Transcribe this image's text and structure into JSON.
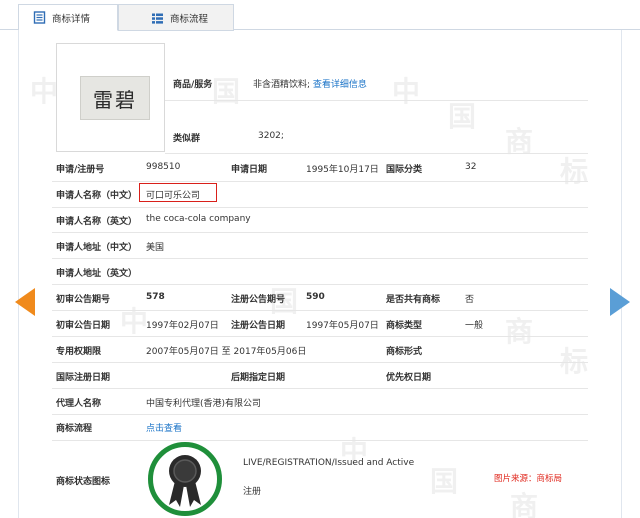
{
  "tabs": [
    {
      "label": "商标详情",
      "icon": "document-icon",
      "active": true
    },
    {
      "label": "商标流程",
      "icon": "list-icon",
      "active": false
    }
  ],
  "watermark": [
    "中",
    "国",
    "商",
    "标"
  ],
  "trademark_image_text": "雷碧",
  "goods": {
    "label": "商品/服务",
    "value": "非含酒精饮料;",
    "link": "查看详细信息"
  },
  "similar_group": {
    "label": "类似群",
    "value": "3202;"
  },
  "rows": {
    "reg_no": {
      "label": "申请/注册号",
      "value": "998510"
    },
    "app_date": {
      "label": "申请日期",
      "value": "1995年10月17日"
    },
    "intl_class": {
      "label": "国际分类",
      "value": "32"
    },
    "applicant_cn": {
      "label": "申请人名称（中文）",
      "value": "可口可乐公司"
    },
    "applicant_en": {
      "label": "申请人名称（英文）",
      "value": "the coca-cola company"
    },
    "address_cn": {
      "label": "申请人地址（中文）",
      "value": "美国"
    },
    "address_en": {
      "label": "申请人地址（英文）",
      "value": ""
    },
    "prelim_issue": {
      "label": "初审公告期号",
      "value": "578"
    },
    "reg_issue": {
      "label": "注册公告期号",
      "value": "590"
    },
    "shared": {
      "label": "是否共有商标",
      "value": "否"
    },
    "prelim_date": {
      "label": "初审公告日期",
      "value": "1997年02月07日"
    },
    "reg_date": {
      "label": "注册公告日期",
      "value": "1997年05月07日"
    },
    "tm_type": {
      "label": "商标类型",
      "value": "一般"
    },
    "exclusive_period": {
      "label": "专用权期限",
      "value": "2007年05月07日 至 2017年05月06日"
    },
    "tm_form": {
      "label": "商标形式",
      "value": ""
    },
    "intl_reg_date": {
      "label": "国际注册日期",
      "value": ""
    },
    "later_date": {
      "label": "后期指定日期",
      "value": ""
    },
    "priority_date": {
      "label": "优先权日期",
      "value": ""
    },
    "agent": {
      "label": "代理人名称",
      "value": "中国专利代理(香港)有限公司"
    },
    "process": {
      "label": "商标流程",
      "link": "点击查看"
    },
    "status": {
      "label": "商标状态图标",
      "line1": "LIVE/REGISTRATION/Issued and Active",
      "line2": "注册"
    }
  },
  "source_note": "图片来源：商标局",
  "colors": {
    "highlight_border": "#d9201a",
    "link": "#1a73c7",
    "status_ring": "#1f8f3a",
    "prev_arrow": "#f08a1c",
    "next_arrow": "#5a9ed6"
  }
}
